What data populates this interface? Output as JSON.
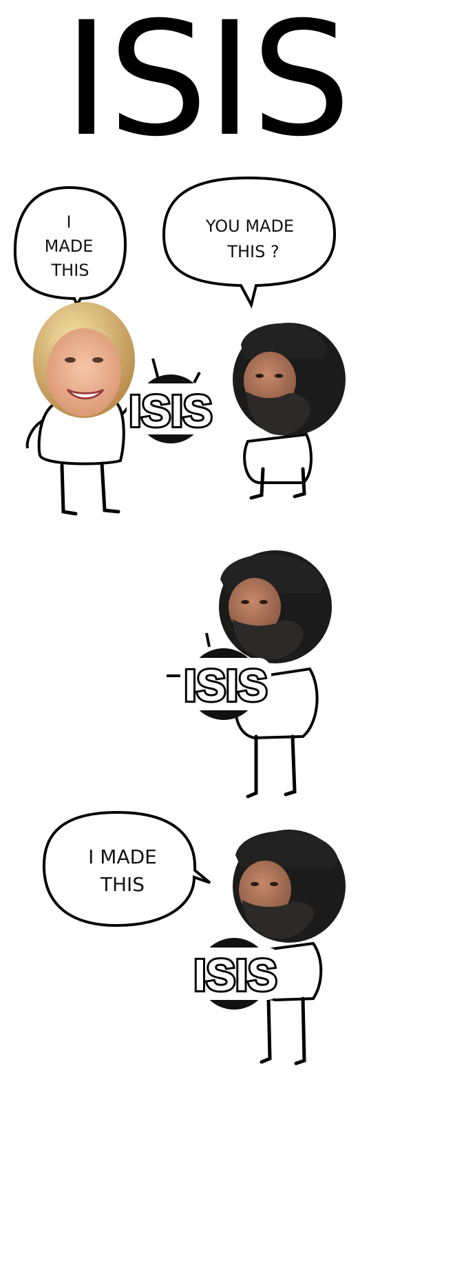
{
  "title": "ISIS",
  "panels": [
    {
      "bubbles": [
        {
          "lines": [
            "I",
            "MADE",
            "THIS"
          ]
        },
        {
          "lines": [
            "YOU MADE",
            "THIS ?"
          ]
        }
      ],
      "badge": "ISIS"
    },
    {
      "badge": "ISIS"
    },
    {
      "bubbles": [
        {
          "lines": [
            "I MADE",
            "THIS"
          ]
        }
      ],
      "badge": "ISIS"
    }
  ]
}
